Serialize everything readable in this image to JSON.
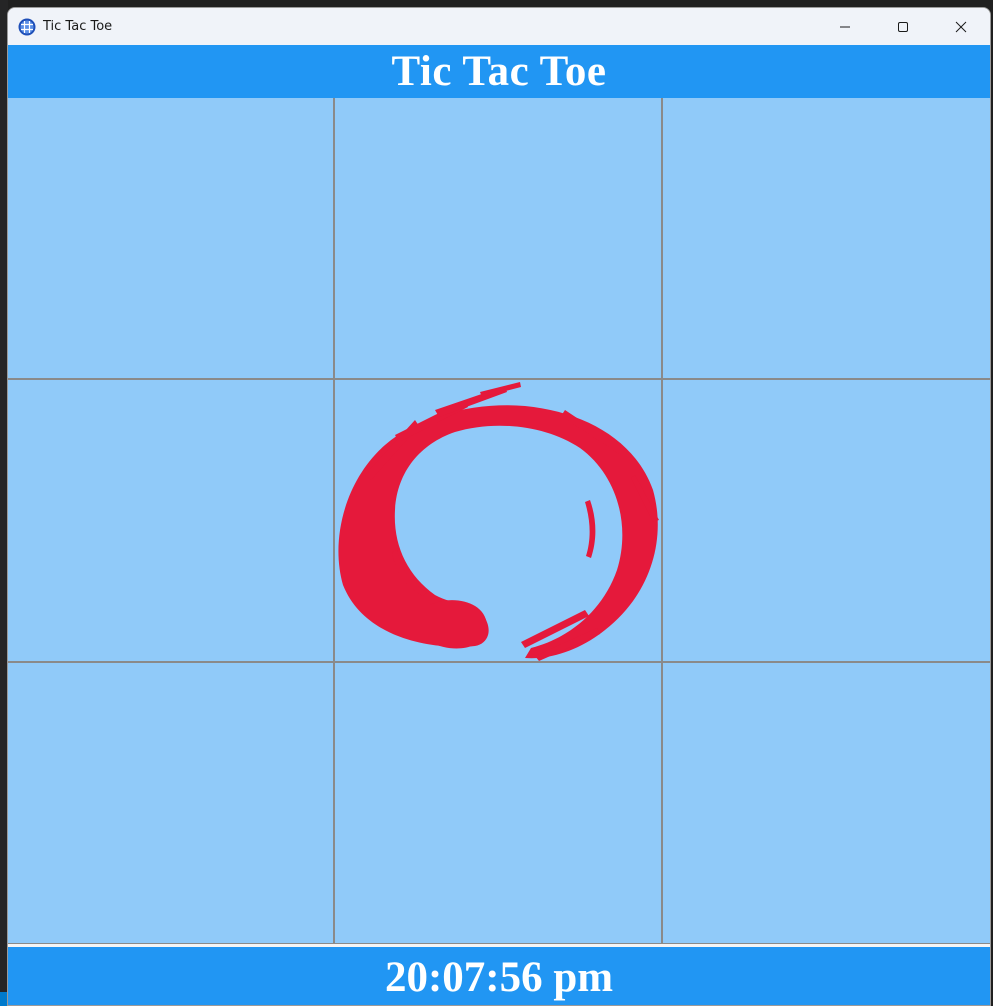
{
  "window": {
    "title": "Tic Tac Toe",
    "app_icon": "tic-tac-toe-grid-icon",
    "controls": [
      "minimize-icon",
      "maximize-icon",
      "close-icon"
    ]
  },
  "header": {
    "title": "Tic Tac Toe"
  },
  "board": {
    "rows": 3,
    "cols": 3,
    "cells": [
      "",
      "",
      "",
      "",
      "O",
      "",
      "",
      "",
      ""
    ],
    "marks": {
      "O": "red-enso-circle"
    }
  },
  "footer": {
    "clock": "20:07:56 pm"
  },
  "colors": {
    "bar": "#2196f3",
    "cell": "#90caf9",
    "grid_line": "#8a8a8a",
    "o_mark": "#e5193b"
  }
}
